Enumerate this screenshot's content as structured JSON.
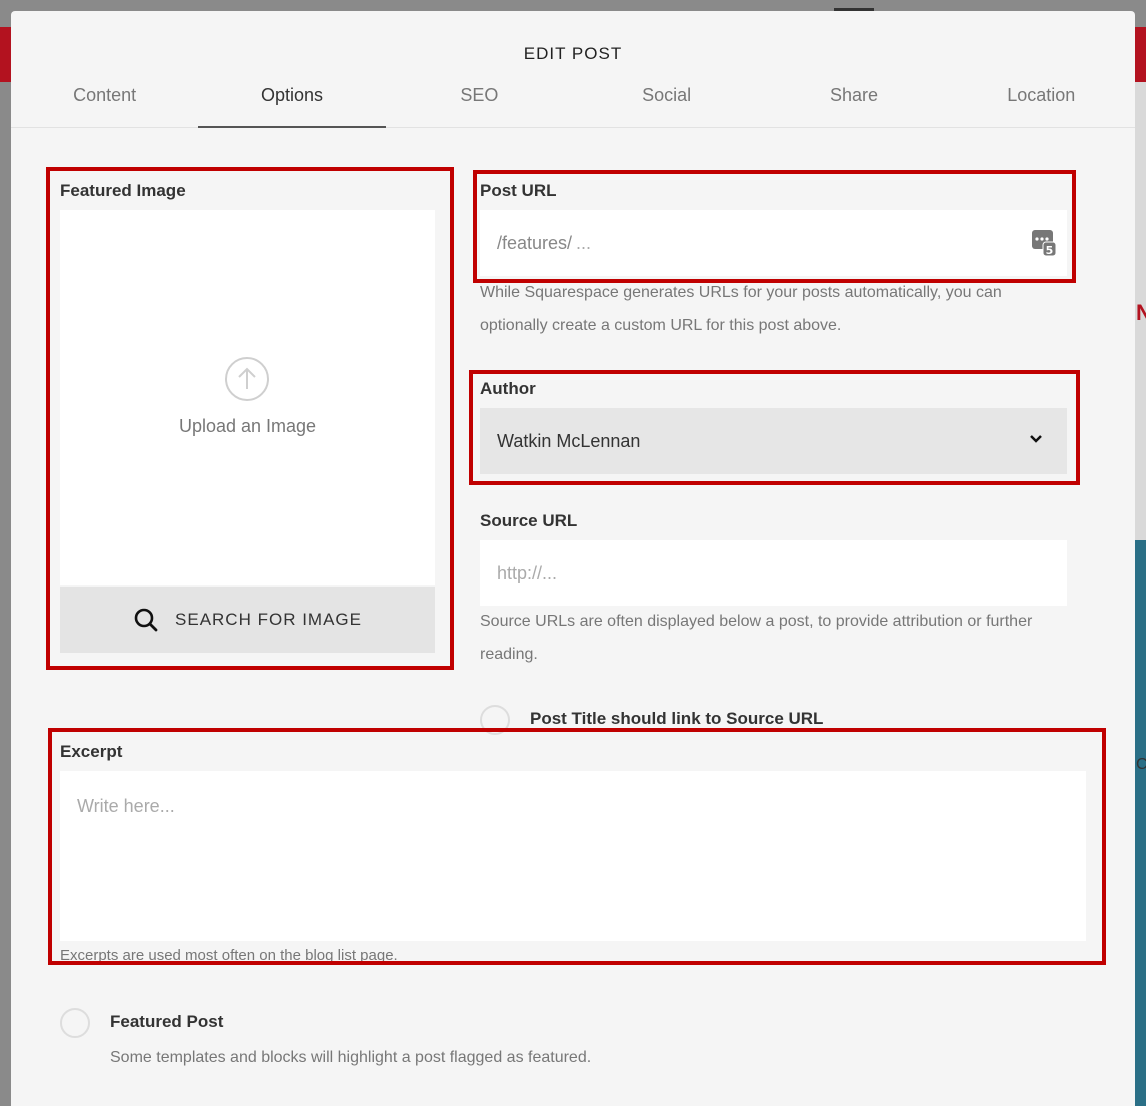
{
  "modal": {
    "title": "EDIT POST",
    "tabs": [
      "Content",
      "Options",
      "SEO",
      "Social",
      "Share",
      "Location"
    ],
    "active_tab": "Options"
  },
  "featured_image": {
    "label": "Featured Image",
    "upload_text": "Upload an Image",
    "search_button": "SEARCH FOR IMAGE"
  },
  "post_url": {
    "label": "Post URL",
    "prefix": "/features/",
    "placeholder": "...",
    "help": "While Squarespace generates URLs for your posts automatically, you can optionally create a custom URL for this post above."
  },
  "author": {
    "label": "Author",
    "value": "Watkin McLennan"
  },
  "source_url": {
    "label": "Source URL",
    "placeholder": "http://...",
    "help": "Source URLs are often displayed below a post, to provide attribution or further reading.",
    "link_option": "Post Title should link to Source URL"
  },
  "excerpt": {
    "label": "Excerpt",
    "placeholder": "Write here...",
    "help": "Excerpts are used most often on the blog list page."
  },
  "featured_post": {
    "label": "Featured Post",
    "help": "Some templates and blocks will highlight a post flagged as featured."
  },
  "colors": {
    "highlight": "#c00000",
    "modal_bg": "#f5f5f5"
  }
}
